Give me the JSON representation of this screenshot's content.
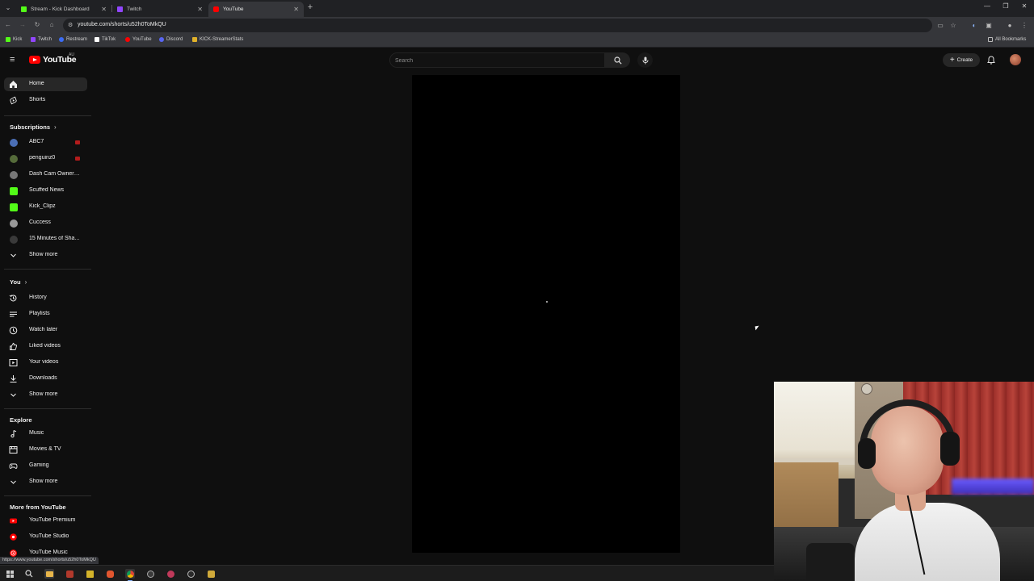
{
  "browser": {
    "tabs": [
      {
        "title": "Stream - Kick Dashboard",
        "color": "#53fc18",
        "active": false
      },
      {
        "title": "Twitch",
        "color": "#9146ff",
        "active": false
      },
      {
        "title": "YouTube",
        "color": "#ff0000",
        "active": true
      }
    ],
    "url": "youtube.com/shorts/u52h0ToMkQU",
    "bookmarks": [
      {
        "label": "Kick",
        "color": "#53fc18"
      },
      {
        "label": "Twitch",
        "color": "#9146ff"
      },
      {
        "label": "Restream",
        "color": "#3b6cf6"
      },
      {
        "label": "TikTok",
        "color": "#ffffff"
      },
      {
        "label": "YouTube",
        "color": "#ff0000"
      },
      {
        "label": "Discord",
        "color": "#5865f2"
      },
      {
        "label": "KICK-StreamerStats",
        "color": "#e0b12a"
      }
    ],
    "all_bookmarks_label": "All Bookmarks",
    "status_url": "https://www.youtube.com/shorts/u52h0ToMkQU"
  },
  "header": {
    "logo_text": "YouTube",
    "region": "AU",
    "search_placeholder": "Search",
    "create_label": "Create"
  },
  "sidebar": {
    "primary": [
      {
        "label": "Home",
        "icon": "home-icon",
        "active": true
      },
      {
        "label": "Shorts",
        "icon": "shorts-icon",
        "active": false
      }
    ],
    "subscriptions_title": "Subscriptions",
    "subscriptions": [
      {
        "label": "ABC7",
        "color": "#4b6fb5",
        "live": true
      },
      {
        "label": "penguinz0",
        "color": "#556b3a",
        "live": true
      },
      {
        "label": "Dash Cam Owners ...",
        "color": "#777777",
        "live": false
      },
      {
        "label": "Scuffed News",
        "color": "#53fc18",
        "live": false
      },
      {
        "label": "Kick_Clipz",
        "color": "#53fc18",
        "live": false
      },
      {
        "label": "Cuccess",
        "color": "#9a9a9a",
        "live": false
      },
      {
        "label": "15 Minutes of Sha...",
        "color": "#3a3a3a",
        "live": false
      }
    ],
    "subscriptions_more": "Show more",
    "you_title": "You",
    "you_items": [
      {
        "label": "History",
        "icon": "history-icon"
      },
      {
        "label": "Playlists",
        "icon": "playlists-icon"
      },
      {
        "label": "Watch later",
        "icon": "watch-later-icon"
      },
      {
        "label": "Liked videos",
        "icon": "liked-videos-icon"
      },
      {
        "label": "Your videos",
        "icon": "your-videos-icon"
      },
      {
        "label": "Downloads",
        "icon": "downloads-icon"
      }
    ],
    "you_more": "Show more",
    "explore_title": "Explore",
    "explore_items": [
      {
        "label": "Music",
        "icon": "music-icon"
      },
      {
        "label": "Movies & TV",
        "icon": "movies-icon"
      },
      {
        "label": "Gaming",
        "icon": "gaming-icon"
      }
    ],
    "explore_more": "Show more",
    "more_title": "More from YouTube",
    "more_items": [
      {
        "label": "YouTube Premium",
        "icon": "youtube-premium-icon"
      },
      {
        "label": "YouTube Studio",
        "icon": "youtube-studio-icon"
      },
      {
        "label": "YouTube Music",
        "icon": "youtube-music-icon"
      }
    ]
  }
}
